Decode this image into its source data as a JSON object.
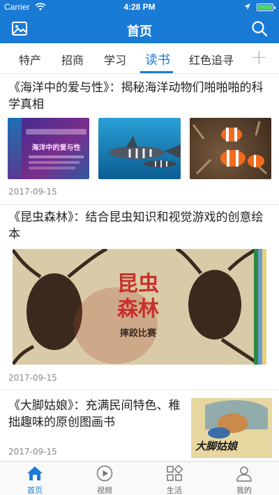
{
  "status": {
    "carrier": "Carrier",
    "time": "4:28 PM"
  },
  "nav": {
    "title": "首页"
  },
  "tabs": [
    {
      "label": "特产"
    },
    {
      "label": "招商"
    },
    {
      "label": "学习"
    },
    {
      "label": "读书",
      "active": true
    },
    {
      "label": "红色追寻"
    }
  ],
  "articles": [
    {
      "title": "《海洋中的爱与性》：揭秘海洋动物们啪啪啪的科学真相",
      "date": "2017-09-15",
      "images": [
        {
          "icon": "ocean-book-cover",
          "caption": "海洋中的爱与性"
        },
        {
          "icon": "sharks-photo"
        },
        {
          "icon": "clownfish-photo"
        }
      ]
    },
    {
      "title": "《昆虫森林》：结合昆虫知识和视觉游戏的创意绘本",
      "date": "2017-09-15",
      "images": [
        {
          "icon": "beetle-book-cover",
          "caption_line1": "昆虫",
          "caption_line2": "森林",
          "subtitle": "摔跤比赛"
        }
      ]
    },
    {
      "title": "《大脚姑娘》：充满民间特色、稚拙趣味的原创图画书",
      "date": "2017-09-15",
      "images": [
        {
          "icon": "bigfoot-book-cover",
          "caption": "大脚姑娘"
        }
      ]
    }
  ],
  "bottom_tabs": [
    {
      "label": "首页",
      "icon": "home-icon",
      "active": true
    },
    {
      "label": "视频",
      "icon": "play-icon"
    },
    {
      "label": "生活",
      "icon": "grid-icon"
    },
    {
      "label": "我的",
      "icon": "user-icon"
    }
  ],
  "colors": {
    "accent": "#1a7bd6",
    "battery": "#4cd964"
  }
}
